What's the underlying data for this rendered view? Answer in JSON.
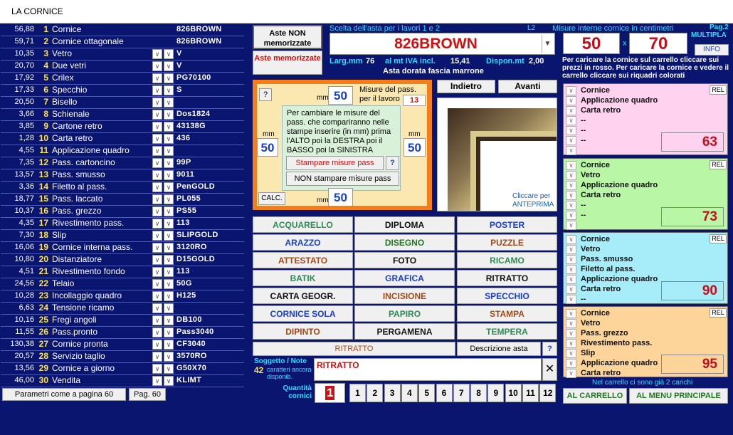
{
  "window": {
    "title": "LA CORNICE"
  },
  "left_list": [
    {
      "price": "56,88",
      "num": "1",
      "label": "Cornice",
      "code": "826BROWN",
      "dd": false
    },
    {
      "price": "59,71",
      "num": "2",
      "label": "Cornice ottagonale",
      "code": "826BROWN",
      "dd": false
    },
    {
      "price": "10,35",
      "num": "3",
      "label": "Vetro",
      "code": "V",
      "dd": true
    },
    {
      "price": "20,70",
      "num": "4",
      "label": "Due vetri",
      "code": "V",
      "dd": true
    },
    {
      "price": "17,92",
      "num": "5",
      "label": "Crilex",
      "code": "PG70100",
      "dd": true
    },
    {
      "price": "17,33",
      "num": "6",
      "label": "Specchio",
      "code": "S",
      "dd": true
    },
    {
      "price": "20,50",
      "num": "7",
      "label": "Bisello",
      "code": "",
      "dd": true
    },
    {
      "price": "3,66",
      "num": "8",
      "label": "Schienale",
      "code": "Dos1824",
      "dd": true
    },
    {
      "price": "3,85",
      "num": "9",
      "label": "Cartone retro",
      "code": "43138G",
      "dd": true
    },
    {
      "price": "1,28",
      "num": "10",
      "label": "Carta retro",
      "code": "436",
      "dd": true
    },
    {
      "price": "4,55",
      "num": "11",
      "label": "Applicazione quadro",
      "code": "",
      "dd": true
    },
    {
      "price": "7,35",
      "num": "12",
      "label": "Pass. cartoncino",
      "code": "99P",
      "dd": true
    },
    {
      "price": "13,57",
      "num": "13",
      "label": "Pass. smusso",
      "code": "9011",
      "dd": true
    },
    {
      "price": "3,36",
      "num": "14",
      "label": "Filetto al pass.",
      "code": "PenGOLD",
      "dd": true
    },
    {
      "price": "18,77",
      "num": "15",
      "label": "Pass. laccato",
      "code": "PL055",
      "dd": true
    },
    {
      "price": "10,37",
      "num": "16",
      "label": "Pass. grezzo",
      "code": "PS55",
      "dd": true
    },
    {
      "price": "4,35",
      "num": "17",
      "label": "Rivestimento pass.",
      "code": "113",
      "dd": true
    },
    {
      "price": "7,30",
      "num": "18",
      "label": "Slip",
      "code": "SLIPGOLD",
      "dd": true
    },
    {
      "price": "16,06",
      "num": "19",
      "label": "Cornice interna pass.",
      "code": "3120RO",
      "dd": true
    },
    {
      "price": "10,80",
      "num": "20",
      "label": "Distanziatore",
      "code": "D15GOLD",
      "dd": true
    },
    {
      "price": "4,51",
      "num": "21",
      "label": "Rivestimento fondo",
      "code": "113",
      "dd": true
    },
    {
      "price": "24,56",
      "num": "22",
      "label": "Telaio",
      "code": "50G",
      "dd": true
    },
    {
      "price": "10,28",
      "num": "23",
      "label": "Incollaggio quadro",
      "code": "H125",
      "dd": true
    },
    {
      "price": "6,63",
      "num": "24",
      "label": "Tensione ricamo",
      "code": "",
      "dd": true
    },
    {
      "price": "10,16",
      "num": "25",
      "label": "Fregi angoli",
      "code": "DB100",
      "dd": true
    },
    {
      "price": "11,55",
      "num": "26",
      "label": "Pass.pronto",
      "code": "Pass3040",
      "dd": true
    },
    {
      "price": "130,38",
      "num": "27",
      "label": "Cornice pronta",
      "code": "CF3040",
      "dd": true
    },
    {
      "price": "20,57",
      "num": "28",
      "label": "Servizio taglio",
      "code": "3570RO",
      "dd": true
    },
    {
      "price": "13,56",
      "num": "29",
      "label": "Cornice a giorno",
      "code": "G50X70",
      "dd": true
    },
    {
      "price": "46,00",
      "num": "30",
      "label": "Vendita",
      "code": "KLIMT",
      "dd": true
    }
  ],
  "bottom_left": {
    "params_btn": "Parametri come a pagina 60",
    "page_btn": "Pag. 60"
  },
  "aste": {
    "non_mem": "Aste NON memorizzate",
    "mem": "Aste memorizzate"
  },
  "asta": {
    "header": "Scelta dell'asta per i lavori 1 e 2",
    "l2": "L2",
    "selected": "826BROWN",
    "larg_label": "Larg.mm",
    "larg_value": "76",
    "iva_label": "al mt IVA incl.",
    "iva_value": "15,41",
    "dispon_label": "Dispon.mt",
    "dispon_value": "2,00",
    "desc": "Asta dorata fascia marrone"
  },
  "misure": {
    "header": "Misure interne cornice in centimetri",
    "pag": "Pag.2",
    "width": "50",
    "x": "x",
    "height": "70",
    "multipla": "MULTIPLA",
    "info": "INFO",
    "note": "Per caricare la cornice sul carrello cliccare sui prezzi in rosso. Per caricare la cornice e vedere il carrello cliccare sui riquadri colorati"
  },
  "pass": {
    "q": "?",
    "mm": "mm",
    "top": "50",
    "left": "50",
    "right": "50",
    "bottom": "50",
    "misure_label": "Misure del pass. per il lavoro",
    "work_num": "13",
    "tip": "Per cambiare le misure del pass. che compariranno nelle stampe inserire (in mm) prima l'ALTO poi la DESTRA poi il BASSO poi la SINISTRA",
    "stampa_btn": "Stampare misure pass",
    "q2": "?",
    "non_stampa_btn": "NON stampare misure pass",
    "calc": "CALC."
  },
  "nav": {
    "back": "Indietro",
    "forward": "Avanti"
  },
  "preview": {
    "text": "Cliccare per ANTEPRIMA"
  },
  "categories": [
    {
      "label": "ACQUARELLO",
      "color": "#2e8b57"
    },
    {
      "label": "DIPLOMA",
      "color": "#111111"
    },
    {
      "label": "POSTER",
      "color": "#1a3ecf"
    },
    {
      "label": "ARAZZO",
      "color": "#1a3ecf"
    },
    {
      "label": "DISEGNO",
      "color": "#1f7a1f"
    },
    {
      "label": "PUZZLE",
      "color": "#a04a1a"
    },
    {
      "label": "ATTESTATO",
      "color": "#a04a1a"
    },
    {
      "label": "FOTO",
      "color": "#111111"
    },
    {
      "label": "RICAMO",
      "color": "#2e8b57"
    },
    {
      "label": "BATIK",
      "color": "#2e8b57"
    },
    {
      "label": "GRAFICA",
      "color": "#1a3ecf"
    },
    {
      "label": "RITRATTO",
      "color": "#111111"
    },
    {
      "label": "CARTA GEOGR.",
      "color": "#111111"
    },
    {
      "label": "INCISIONE",
      "color": "#a04a1a"
    },
    {
      "label": "SPECCHIO",
      "color": "#1a3ecf"
    },
    {
      "label": "CORNICE SOLA",
      "color": "#1a3ecf"
    },
    {
      "label": "PAPIRO",
      "color": "#2e8b57"
    },
    {
      "label": "STAMPA",
      "color": "#a04a1a"
    },
    {
      "label": "DIPINTO",
      "color": "#a04a1a"
    },
    {
      "label": "PERGAMENA",
      "color": "#111111"
    },
    {
      "label": "TEMPERA",
      "color": "#2e8b57"
    }
  ],
  "selection": {
    "ritratto": "RITRATTO",
    "descr_btn": "Descrizione asta",
    "q": "?"
  },
  "notes": {
    "label": "Soggetto / Note",
    "count": "42",
    "count_suffix": "caratteri ancora disponib.",
    "value": "RITRATTO",
    "clear": "✕"
  },
  "quantity": {
    "label": "Quantità cornici",
    "value": "1",
    "buttons": [
      "1",
      "2",
      "3",
      "4",
      "5",
      "6",
      "7",
      "8",
      "9",
      "10",
      "11",
      "12"
    ]
  },
  "cards": [
    {
      "color": "#ffd3f0",
      "items": [
        "Cornice",
        "Applicazione quadro",
        "Carta retro",
        "--",
        "--",
        "--"
      ],
      "price": "63",
      "rel": "REL"
    },
    {
      "color": "#b9f7a6",
      "items": [
        "Cornice",
        "Vetro",
        "Applicazione quadro",
        "Carta retro",
        "--",
        "--"
      ],
      "price": "73",
      "rel": "REL"
    },
    {
      "color": "#a6ecf9",
      "items": [
        "Cornice",
        "Vetro",
        "Pass. smusso",
        "Filetto al pass.",
        "Applicazione quadro",
        "Carta retro",
        "--"
      ],
      "price": "90",
      "rel": "REL"
    },
    {
      "color": "#fdd59b",
      "items": [
        "Cornice",
        "Vetro",
        "Pass. grezzo",
        "Rivestimento pass.",
        "Slip",
        "Applicazione quadro",
        "Carta retro"
      ],
      "price": "95",
      "rel": "REL"
    }
  ],
  "cart": {
    "status": "Nel carrello ci sono già 2 carichi",
    "to_cart": "AL CARRELLO",
    "menu": "AL MENU PRINCIPALE"
  }
}
